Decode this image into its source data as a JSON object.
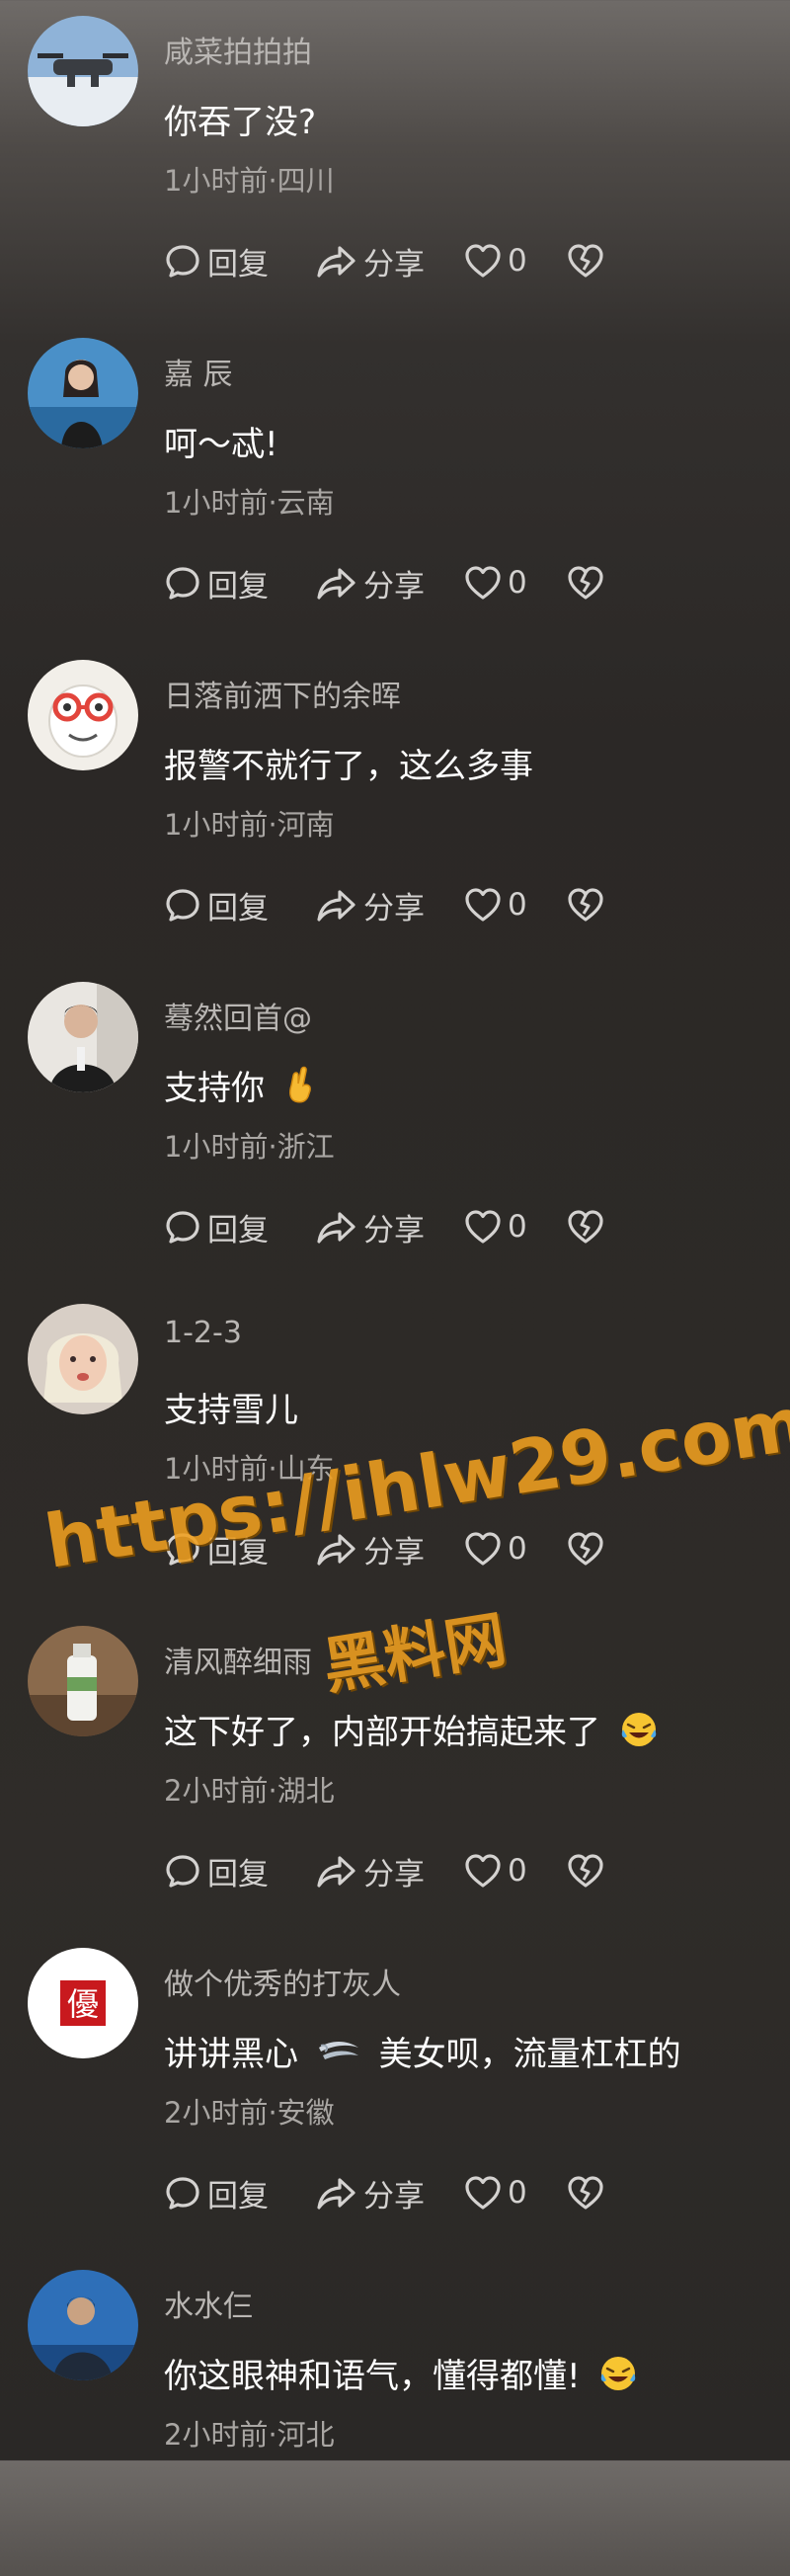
{
  "actions": {
    "reply_label": "回复",
    "share_label": "分享"
  },
  "comments": [
    {
      "username": "咸菜拍拍拍",
      "text": "你吞了没?",
      "meta": "1小时前·四川",
      "likes": "0"
    },
    {
      "username": "嘉 辰",
      "text": "呵～忒!",
      "meta": "1小时前·云南",
      "likes": "0"
    },
    {
      "username": "日落前洒下的余晖",
      "text": "报警不就行了，这么多事",
      "meta": "1小时前·河南",
      "likes": "0"
    },
    {
      "username": "蓦然回首@",
      "text": "支持你",
      "emoji": "fingers-crossed-emoji",
      "meta": "1小时前·浙江",
      "likes": "0"
    },
    {
      "username": "1-2-3",
      "text": "支持雪儿",
      "meta": "1小时前·山东",
      "likes": "0"
    },
    {
      "username": "清风醉细雨",
      "text": "这下好了，内部开始搞起来了",
      "emoji": "laughing-tears-emoji",
      "meta": "2小时前·湖北",
      "likes": "0"
    },
    {
      "username": "做个优秀的打灰人",
      "text_before": "讲讲黑心",
      "emoji": "wind-emoji",
      "text_after": "美女呗，流量杠杠的",
      "meta": "2小时前·安徽",
      "likes": "0",
      "avatar_glyph": "優"
    },
    {
      "username": "水水仨",
      "text": "你这眼神和语气，懂得都懂!",
      "emoji": "laughing-tears-emoji",
      "meta": "2小时前·河北"
    }
  ],
  "watermark": {
    "url": "https://ihlw29.com",
    "name": "黑料网"
  },
  "colors": {
    "username": "#b9b6b3",
    "meta": "#a9a6a3",
    "text": "#ffffff",
    "watermark": "#f0a020"
  }
}
